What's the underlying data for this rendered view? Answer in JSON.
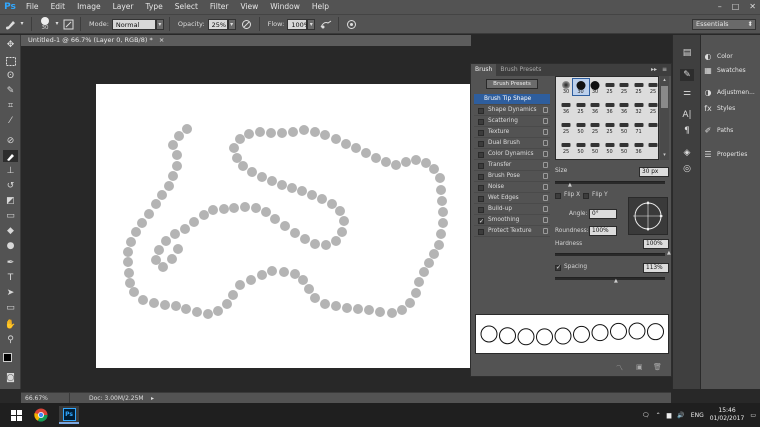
{
  "app": {
    "logo": "Ps"
  },
  "menu": [
    "File",
    "Edit",
    "Image",
    "Layer",
    "Type",
    "Select",
    "Filter",
    "View",
    "Window",
    "Help"
  ],
  "window_controls": [
    "–",
    "□",
    "✕"
  ],
  "options": {
    "brush_size": "30",
    "mode_label": "Mode:",
    "mode_value": "Normal",
    "opacity_label": "Opacity:",
    "opacity_value": "25%",
    "flow_label": "Flow:",
    "flow_value": "100%",
    "workspace": "Essentials"
  },
  "document": {
    "tab_title": "Untitled-1 @ 66.7% (Layer 0, RGB/8) *",
    "close": "×"
  },
  "status": {
    "zoom": "66.67%",
    "doc": "Doc: 3.00M/2.25M"
  },
  "brush_panel": {
    "tabs": [
      "Brush",
      "Brush Presets"
    ],
    "presets_button": "Brush Presets",
    "options": [
      {
        "label": "Brush Tip Shape",
        "checked": false,
        "selected": true,
        "checkbox": false
      },
      {
        "label": "Shape Dynamics",
        "checked": false
      },
      {
        "label": "Scattering",
        "checked": false
      },
      {
        "label": "Texture",
        "checked": false
      },
      {
        "label": "Dual Brush",
        "checked": false
      },
      {
        "label": "Color Dynamics",
        "checked": false
      },
      {
        "label": "Transfer",
        "checked": false
      },
      {
        "label": "Brush Pose",
        "checked": false
      },
      {
        "label": "Noise",
        "checked": false
      },
      {
        "label": "Wet Edges",
        "checked": false
      },
      {
        "label": "Build-up",
        "checked": false
      },
      {
        "label": "Smoothing",
        "checked": true
      },
      {
        "label": "Protect Texture",
        "checked": false
      }
    ],
    "tips": [
      {
        "n": "30",
        "kind": "soft"
      },
      {
        "n": "30",
        "kind": "hard",
        "selected": true
      },
      {
        "n": "30",
        "kind": "hard"
      },
      {
        "n": "25",
        "kind": "dash"
      },
      {
        "n": "25",
        "kind": "dash"
      },
      {
        "n": "25",
        "kind": "dash"
      },
      {
        "n": "25",
        "kind": "dash"
      },
      {
        "n": "36",
        "kind": "dash"
      },
      {
        "n": "25",
        "kind": "dash"
      },
      {
        "n": "36",
        "kind": "dash"
      },
      {
        "n": "36",
        "kind": "dash"
      },
      {
        "n": "36",
        "kind": "dash"
      },
      {
        "n": "32",
        "kind": "dash"
      },
      {
        "n": "25",
        "kind": "dash"
      },
      {
        "n": "25",
        "kind": "dash"
      },
      {
        "n": "50",
        "kind": "dash"
      },
      {
        "n": "25",
        "kind": "dash"
      },
      {
        "n": "25",
        "kind": "dash"
      },
      {
        "n": "50",
        "kind": "dash"
      },
      {
        "n": "71",
        "kind": "dash"
      },
      {
        "n": "",
        "kind": "dash"
      },
      {
        "n": "25",
        "kind": "dash"
      },
      {
        "n": "50",
        "kind": "dash"
      },
      {
        "n": "50",
        "kind": "dash"
      },
      {
        "n": "50",
        "kind": "dash"
      },
      {
        "n": "50",
        "kind": "dash"
      },
      {
        "n": "36",
        "kind": "dash"
      },
      {
        "n": "",
        "kind": "dash"
      }
    ],
    "size_label": "Size",
    "size_value": "30 px",
    "flip_x": "Flip X",
    "flip_y": "Flip Y",
    "angle_label": "Angle:",
    "angle_value": "0°",
    "roundness_label": "Roundness:",
    "roundness_value": "100%",
    "hardness_label": "Hardness",
    "hardness_value": "100%",
    "spacing_label": "Spacing",
    "spacing_value": "113%",
    "spacing_checked": true,
    "preview_dots": 10
  },
  "right_panels": [
    {
      "label": "Color",
      "icon": "color-icon"
    },
    {
      "label": "Swatches",
      "icon": "swatches-icon"
    },
    {
      "label": "Adjustmen...",
      "icon": "adjustments-icon"
    },
    {
      "label": "Styles",
      "icon": "styles-icon"
    },
    {
      "label": "Paths",
      "icon": "paths-icon"
    },
    {
      "label": "Properties",
      "icon": "properties-icon"
    }
  ],
  "taskbar": {
    "lang": "ENG",
    "time": "15:46",
    "date": "01/02/2017"
  },
  "colors": {
    "dots": "#b4b4b4",
    "accent": "#31a8ff",
    "selection": "#2e5e9e"
  }
}
